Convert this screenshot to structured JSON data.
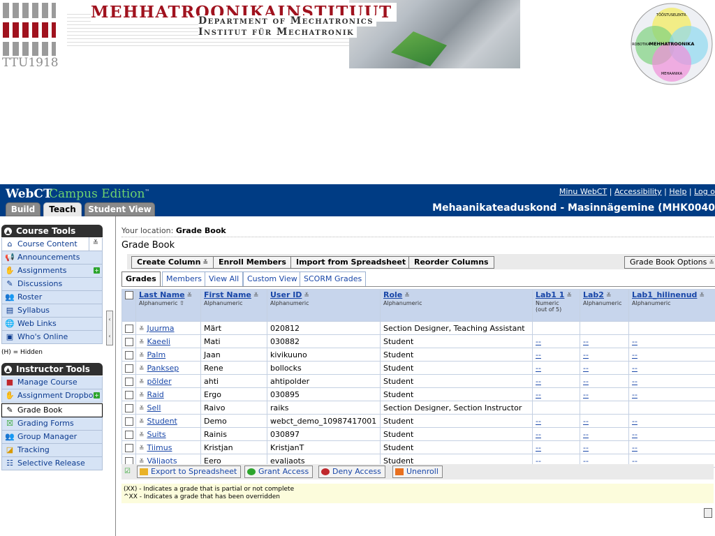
{
  "banner": {
    "ttu_text": "TTU1918",
    "institute": "MEHHATROONIKAINSTITUUT",
    "dept_en": "Department of Mechatronics",
    "dept_de": "Institut für Mechatronik",
    "venn_labels": [
      "Tööstuselektroonika",
      "Elektrotehnika",
      "Infotehnoloogia",
      "MEHHATROONIKA",
      "ROBOTIKA",
      "MEHAANIKA"
    ]
  },
  "header": {
    "brand_webct": "WebCT",
    "brand_ce": "Campus Edition",
    "brand_tm": "™",
    "links": [
      "Minu WebCT",
      "Accessibility",
      "Help",
      "Log o"
    ],
    "course_title": "Mehaanikateaduskond - Masinnägemine (MHK0040",
    "tabs": [
      "Build",
      "Teach",
      "Student View"
    ]
  },
  "nav": {
    "course_tools_title": "Course Tools",
    "course_tools": [
      {
        "label": "Course Content",
        "icon": "home-icon"
      },
      {
        "label": "Announcements",
        "icon": "megaphone-icon"
      },
      {
        "label": "Assignments",
        "icon": "hand-icon"
      },
      {
        "label": "Discussions",
        "icon": "pin-icon"
      },
      {
        "label": "Roster",
        "icon": "people-icon"
      },
      {
        "label": "Syllabus",
        "icon": "folder-icon"
      },
      {
        "label": "Web Links",
        "icon": "globe-icon"
      },
      {
        "label": "Who's Online",
        "icon": "screen-icon"
      }
    ],
    "hidden_note": "(H) = Hidden",
    "instructor_tools_title": "Instructor Tools",
    "instructor_tools": [
      {
        "label": "Manage Course",
        "icon": "cube-icon"
      },
      {
        "label": "Assignment Dropbox",
        "icon": "dropbox-icon"
      },
      {
        "label": "Grade Book",
        "icon": "gradebook-icon"
      },
      {
        "label": "Grading Forms",
        "icon": "form-icon"
      },
      {
        "label": "Group Manager",
        "icon": "group-icon"
      },
      {
        "label": "Tracking",
        "icon": "chart-icon"
      },
      {
        "label": "Selective Release",
        "icon": "release-icon"
      }
    ]
  },
  "main": {
    "location_label": "Your location:",
    "location_value": "Grade Book",
    "page_title": "Grade Book",
    "toolbar": {
      "create_column": "Create Column",
      "enroll_members": "Enroll Members",
      "import": "Import from Spreadsheet",
      "reorder": "Reorder Columns",
      "options": "Grade Book Options"
    },
    "subtabs": [
      "Grades",
      "Members",
      "View All",
      "Custom View",
      "SCORM Grades"
    ],
    "columns": [
      {
        "name": "Last Name",
        "type": "Alphanumeric"
      },
      {
        "name": "First Name",
        "type": "Alphanumeric"
      },
      {
        "name": "User ID",
        "type": "Alphanumeric"
      },
      {
        "name": "Role",
        "type": "Alphanumeric"
      },
      {
        "name": "Lab1 1",
        "type": "Numeric (out of 5)"
      },
      {
        "name": "Lab2",
        "type": "Alphanumeric"
      },
      {
        "name": "Lab1_hilinenud",
        "type": "Alphanumeric"
      }
    ],
    "rows": [
      {
        "last": "Juurma",
        "first": "Märt",
        "uid": "020812",
        "role": "Section Designer, Teaching Assistant",
        "lab1": "",
        "lab2": "",
        "lab1h": ""
      },
      {
        "last": "Kaeeli",
        "first": "Mati",
        "uid": "030882",
        "role": "Student",
        "lab1": "--",
        "lab2": "--",
        "lab1h": "--"
      },
      {
        "last": "Palm",
        "first": "Jaan",
        "uid": "kivikuuno",
        "role": "Student",
        "lab1": "--",
        "lab2": "--",
        "lab1h": "--"
      },
      {
        "last": "Panksep",
        "first": "Rene",
        "uid": "bollocks",
        "role": "Student",
        "lab1": "--",
        "lab2": "--",
        "lab1h": "--"
      },
      {
        "last": "põlder",
        "first": "ahti",
        "uid": "ahtipolder",
        "role": "Student",
        "lab1": "--",
        "lab2": "--",
        "lab1h": "--"
      },
      {
        "last": "Raid",
        "first": "Ergo",
        "uid": "030895",
        "role": "Student",
        "lab1": "--",
        "lab2": "--",
        "lab1h": "--"
      },
      {
        "last": "Sell",
        "first": "Raivo",
        "uid": "raiks",
        "role": "Section Designer, Section Instructor",
        "lab1": "",
        "lab2": "",
        "lab1h": ""
      },
      {
        "last": "Student",
        "first": "Demo",
        "uid": "webct_demo_10987417001",
        "role": "Student",
        "lab1": "--",
        "lab2": "--",
        "lab1h": "--"
      },
      {
        "last": "Suits",
        "first": "Rainis",
        "uid": "030897",
        "role": "Student",
        "lab1": "--",
        "lab2": "--",
        "lab1h": "--"
      },
      {
        "last": "Tiimus",
        "first": "Kristjan",
        "uid": "KristjanT",
        "role": "Student",
        "lab1": "--",
        "lab2": "--",
        "lab1h": "--"
      },
      {
        "last": "Väljaots",
        "first": "Eero",
        "uid": "evaljaots",
        "role": "Student",
        "lab1": "--",
        "lab2": "--",
        "lab1h": "--"
      }
    ],
    "actions": [
      "Export to Spreadsheet",
      "Grant Access",
      "Deny Access",
      "Unenroll"
    ],
    "legend": [
      "(XX) - Indicates a grade that is partial or not complete",
      "^XX - Indicates a grade that has been overridden"
    ]
  }
}
